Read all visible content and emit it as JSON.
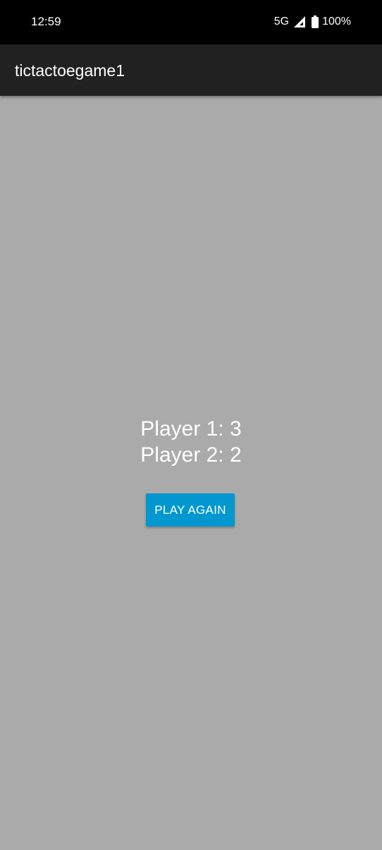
{
  "status_bar": {
    "time": "12:59",
    "network": "5G",
    "battery": "100%",
    "icons": [
      "signal-icon",
      "battery-icon"
    ]
  },
  "app_bar": {
    "title": "tictactoegame1"
  },
  "scores": {
    "player1": "Player 1: 3",
    "player2": "Player 2: 2"
  },
  "actions": {
    "play_again_label": "PLAY AGAIN"
  },
  "colors": {
    "background": "#AAAAAA",
    "app_bar": "#212121",
    "status_bar": "#000000",
    "button": "#0298CF",
    "text": "#FFFFFF"
  }
}
